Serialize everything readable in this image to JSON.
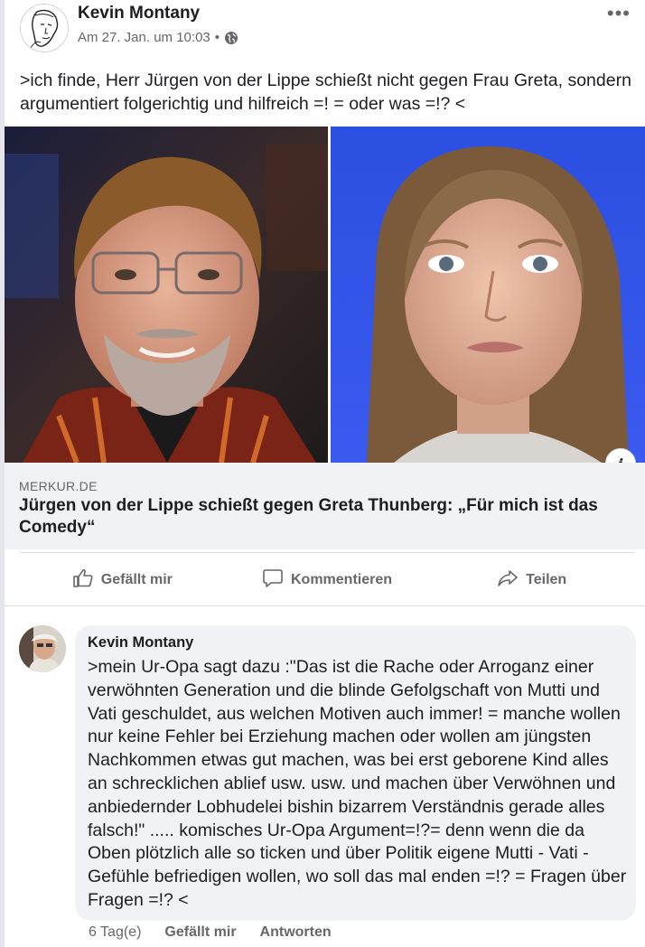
{
  "post": {
    "author": "Kevin Montany",
    "timestamp": "Am 27. Jan. um 10:03",
    "separator": "•",
    "privacy_icon": "globe-icon",
    "more_icon": "more-options-icon",
    "more_label": "•••",
    "text": ">ich finde, Herr Jürgen von der Lippe schießt nicht gegen Frau Greta, sondern argumentiert folgerichtig und hilfreich =! = oder was =!? <"
  },
  "link_preview": {
    "images": [
      "portrait-man-icon",
      "portrait-girl-icon"
    ],
    "info_label": "i",
    "domain": "MERKUR.DE",
    "title": "Jürgen von der Lippe schießt gegen Greta Thunberg: „Für mich ist das Comedy“"
  },
  "actions": {
    "like": "Gefällt mir",
    "comment": "Kommentieren",
    "share": "Teilen"
  },
  "comment": {
    "author": "Kevin Montany",
    "text": ">mein Ur-Opa sagt dazu :\"Das ist die Rache oder Arroganz einer verwöhnten Generation und die blinde Gefolgschaft von Mutti und Vati geschuldet,  aus welchen Motiven auch immer! = manche wollen nur keine Fehler bei Erziehung machen oder wollen am jüngsten Nachkommen etwas gut machen, was bei erst geborene Kind alles an schrecklichen ablief usw. usw. und machen über Verwöhnen und anbiedernder Lobhudelei bishin bizarrem Verständnis gerade alles falsch!\" ..... komisches Ur-Opa Argument=!?= denn wenn die da Oben plötzlich alle so ticken und über Politik eigene Mutti - Vati - Gefühle befriedigen wollen, wo soll das mal  enden =!? = Fragen über Fragen =!? <",
    "age": "6 Tag(e)",
    "like": "Gefällt mir",
    "reply": "Antworten"
  },
  "colors": {
    "text": "#1c1e21",
    "secondary": "#65676b",
    "card_bg": "#f0f2f5",
    "divider": "#dadde1"
  }
}
